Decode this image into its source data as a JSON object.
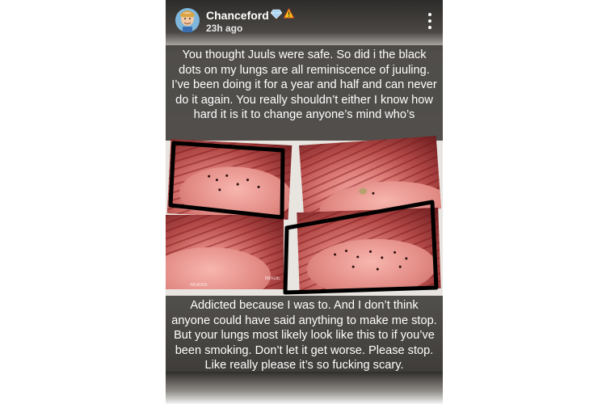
{
  "story": {
    "username": "Chanceford",
    "timestamp": "23h ago",
    "badges": [
      "diamond-icon",
      "warning-icon"
    ]
  },
  "captions": {
    "top": "You thought Juuls were safe. So did i the black dots on my lungs are all reminiscence of juuling. I’ve been doing it for a year and half and can never do it again. You really shouldn’t either I know how hard it is it to change anyone’s mind who’s",
    "bottom": "Addicted because I was to. And I don’t think anyone could have said anything to make me stop. But your lungs most likely look like this to if you’ve been smoking. Don’t let it get worse. Please stop. Like really please it’s so fucking scary."
  },
  "photos": {
    "labels": [
      "IMAGE",
      "AK3003"
    ]
  },
  "colors": {
    "caption_bg": "#3c3a37",
    "annotation": "#000000",
    "lung_tissue": "#e48d87"
  }
}
